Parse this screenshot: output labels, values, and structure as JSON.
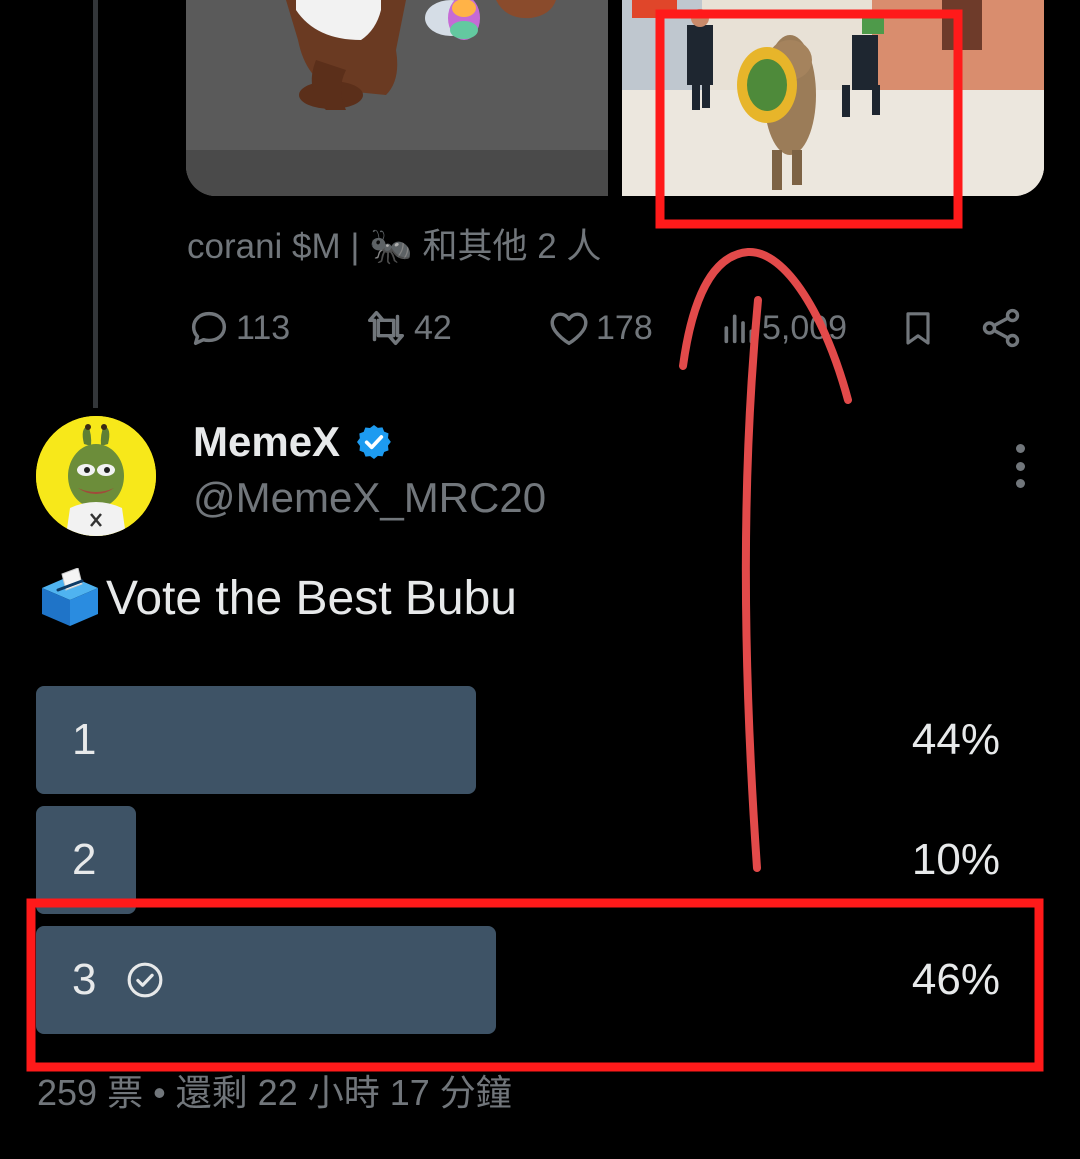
{
  "previous_tweet": {
    "media": [
      {
        "icon": "cartoon-bear-image"
      },
      {
        "icon": "cat-running-from-police-image"
      }
    ],
    "likers_text": "corani $M | 🐜 和其他 2 人",
    "actions": {
      "reply_count": "113",
      "retweet_count": "42",
      "like_count": "178",
      "views_count": "5,009"
    }
  },
  "tweet": {
    "display_name": "MemeX",
    "handle": "@MemeX_MRC20",
    "text": "Vote the Best Bubu",
    "emoji_icon": "ballot-box-icon"
  },
  "poll": {
    "options": [
      {
        "label": "1",
        "percent": "44%",
        "fraction": 0.44
      },
      {
        "label": "2",
        "percent": "10%",
        "fraction": 0.1
      },
      {
        "label": "3",
        "percent": "46%",
        "fraction": 0.46,
        "selected": true
      }
    ],
    "meta": "259 票 • 還剩 22 小時 17 分鐘"
  },
  "colors": {
    "background": "#000000",
    "text": "#e7e9ea",
    "muted": "#71767b",
    "poll_bar": "#3e5366",
    "verified": "#1d9bf0",
    "annotation": "#ff1a1a"
  }
}
